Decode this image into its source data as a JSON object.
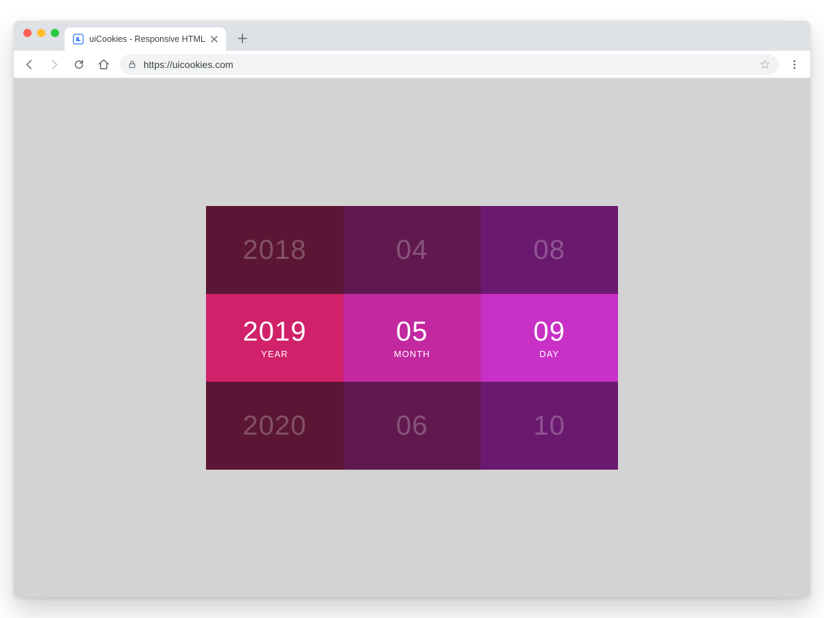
{
  "browser": {
    "tab_title": "uiCookies - Responsive HTML",
    "url": "https://uicookies.com"
  },
  "picker": {
    "year": {
      "prev": "2018",
      "current": "2019",
      "next": "2020",
      "label": "YEAR"
    },
    "month": {
      "prev": "04",
      "current": "05",
      "next": "06",
      "label": "MONTH"
    },
    "day": {
      "prev": "08",
      "current": "09",
      "next": "10",
      "label": "DAY"
    }
  }
}
